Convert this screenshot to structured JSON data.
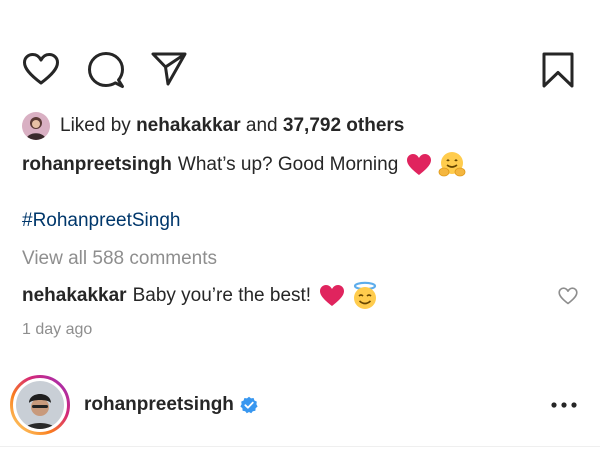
{
  "actions": {
    "like_icon": "heart-outline-icon",
    "comment_icon": "comment-bubble-icon",
    "share_icon": "paper-plane-icon",
    "save_icon": "bookmark-icon"
  },
  "likes": {
    "prefix": "Liked by",
    "liker": "nehakakkar",
    "connector": "and",
    "count_text": "37,792 others"
  },
  "caption": {
    "username": "rohanpreetsingh",
    "text": "What’s up? Good Morning",
    "emojis": [
      "red-heart-emoji",
      "hugging-face-emoji"
    ]
  },
  "hashtag": "#RohanpreetSingh",
  "view_comments": "View all 588 comments",
  "top_comment": {
    "username": "nehakakkar",
    "text": "Baby you’re the best!",
    "emojis": [
      "red-heart-emoji",
      "smiling-face-with-halo-emoji"
    ]
  },
  "timestamp": "1 day ago",
  "profile": {
    "username": "rohanpreetsingh",
    "verified": true
  },
  "colors": {
    "text": "#262626",
    "muted": "#8e8e8e",
    "hashtag": "#00376b",
    "verified_blue": "#3897f0",
    "heart_red": "#e0245e"
  }
}
